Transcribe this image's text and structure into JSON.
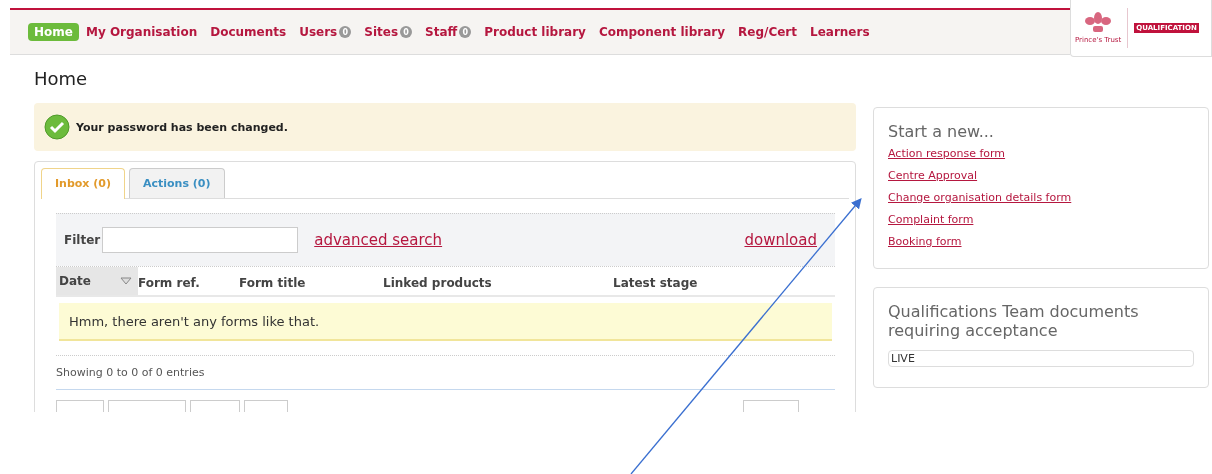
{
  "nav": {
    "items": [
      {
        "label": "Home",
        "selected": true
      },
      {
        "label": "My Organisation",
        "selected": false
      },
      {
        "label": "Documents",
        "selected": false
      },
      {
        "label": "Users",
        "badge": "0",
        "selected": false
      },
      {
        "label": "Sites",
        "badge": "0",
        "selected": false
      },
      {
        "label": "Staff",
        "badge": "0",
        "selected": false
      },
      {
        "label": "Product library",
        "selected": false
      },
      {
        "label": "Component library",
        "selected": false
      },
      {
        "label": "Reg/Cert",
        "selected": false
      },
      {
        "label": "Learners",
        "selected": false
      }
    ],
    "logo": {
      "caption": "Prince's Trust",
      "tag": "QUALIFICATION"
    }
  },
  "page_title": "Home",
  "alert": "Your password has been changed.",
  "tabs": [
    {
      "label": "Inbox (0)",
      "selected": true
    },
    {
      "label": "Actions (0)",
      "selected": false
    }
  ],
  "filter": {
    "label": "Filter",
    "advanced_search": "advanced search",
    "download": "download"
  },
  "table": {
    "columns": [
      "Date",
      "Form ref.",
      "Form title",
      "Linked products",
      "Latest stage"
    ],
    "empty_message": "Hmm, there aren't any forms like that."
  },
  "info": "Showing 0 to 0 of 0 entries",
  "start_new": {
    "title": "Start a new...",
    "links": [
      "Action response form",
      "Centre Approval",
      "Change organisation details form",
      "Complaint form",
      "Booking form"
    ]
  },
  "documents": {
    "title": "Qualifications Team documents requiring acceptance",
    "items": [
      "LIVE"
    ]
  }
}
